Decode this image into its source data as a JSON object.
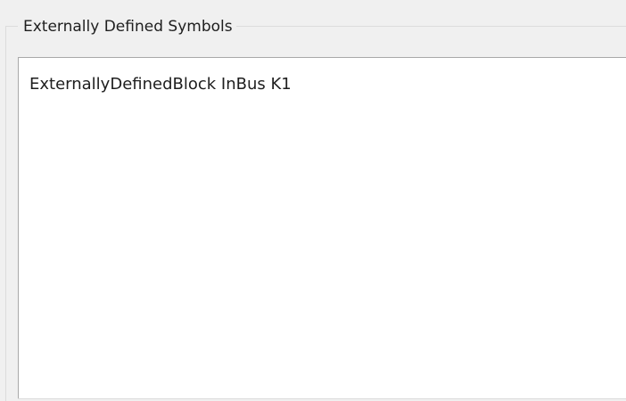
{
  "groupbox": {
    "title": "Externally Defined Symbols"
  },
  "symbols_list": {
    "items": [
      {
        "label": "ExternallyDefinedBlock InBus K1"
      }
    ]
  }
}
